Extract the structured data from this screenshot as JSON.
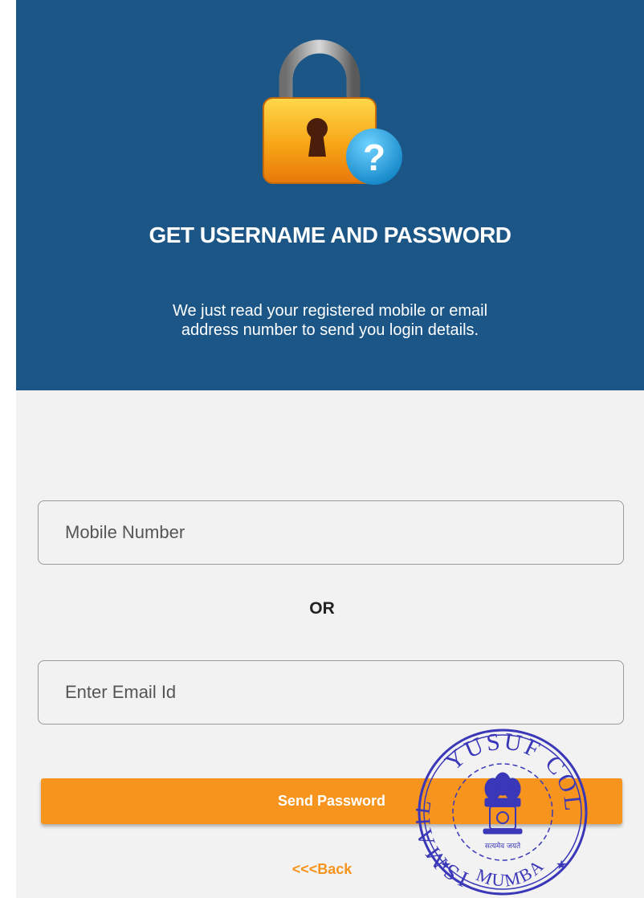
{
  "header": {
    "title": "GET USERNAME AND PASSWORD",
    "subtitle_line1": "We just read your registered mobile or email",
    "subtitle_line2": "address number to send you login details.",
    "icon": "lock-question-icon"
  },
  "form": {
    "mobile_placeholder": "Mobile Number",
    "or_label": "OR",
    "email_placeholder": "Enter Email Id",
    "send_button_label": "Send Password",
    "back_link_label": "<<<Back"
  },
  "seal": {
    "top_text": "YUSUF COLLEGE",
    "left_text": "ISMAIL",
    "bottom_text": "MUMBAI",
    "center_text": "सत्यमेव जयते",
    "icon": "emblem-icon"
  },
  "colors": {
    "header_bg": "#1b5687",
    "accent": "#f7941d",
    "page_bg": "#f2f2f2",
    "seal": "#3a37b8"
  }
}
